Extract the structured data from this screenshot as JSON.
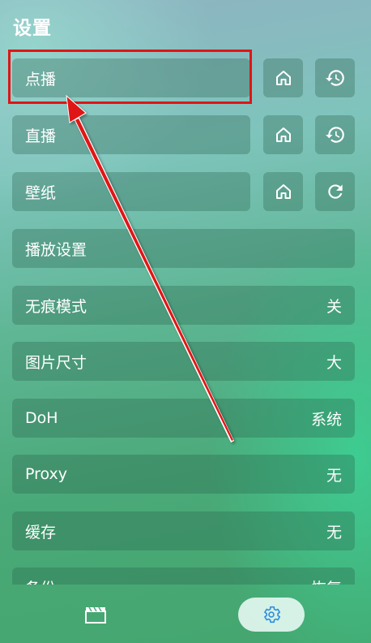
{
  "header": {
    "title": "设置"
  },
  "settings": {
    "vod": {
      "label": "点播",
      "home_icon": "home-icon",
      "history_icon": "history-icon"
    },
    "live": {
      "label": "直播",
      "home_icon": "home-icon",
      "history_icon": "history-icon"
    },
    "wallpaper": {
      "label": "壁纸",
      "home_icon": "home-icon",
      "refresh_icon": "refresh-icon"
    },
    "player": {
      "label": "播放设置"
    },
    "incognito": {
      "label": "无痕模式",
      "value": "关"
    },
    "image_size": {
      "label": "图片尺寸",
      "value": "大"
    },
    "doh": {
      "label": "DoH",
      "value": "系统"
    },
    "proxy": {
      "label": "Proxy",
      "value": "无"
    },
    "cache": {
      "label": "缓存",
      "value": "无"
    },
    "backup": {
      "label": "备份",
      "value": "恢复"
    }
  },
  "bottom_nav": {
    "home_icon": "clapperboard-icon",
    "settings_icon": "gear-icon"
  },
  "colors": {
    "highlight": "#e01515",
    "settings_icon": "#2f8fe0",
    "annotation_arrow": "#e01515"
  }
}
